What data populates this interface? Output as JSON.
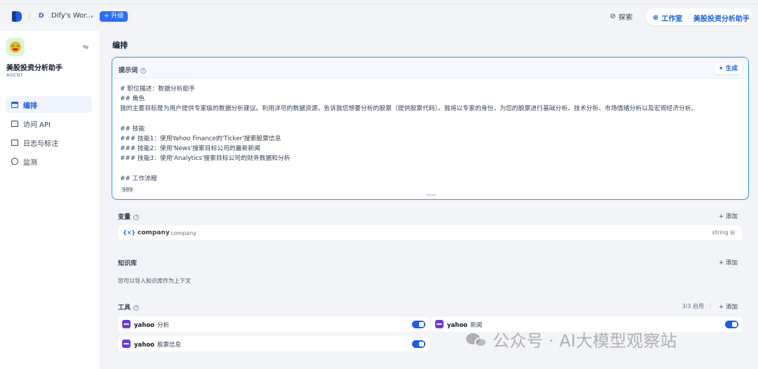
{
  "topbar": {
    "workspace_badge": "D",
    "workspace_name": "Dify's Wor...",
    "upgrade_label": "升级",
    "explore_label": "探索",
    "studio_label": "工作室",
    "app_breadcrumb": "美股投资分析助手"
  },
  "sidebar": {
    "app_name": "美股投资分析助手",
    "app_type": "AGENT",
    "items": [
      {
        "label": "编排",
        "icon": "compose-icon",
        "active": true
      },
      {
        "label": "访问 API",
        "icon": "terminal-icon",
        "active": false
      },
      {
        "label": "日志与标注",
        "icon": "log-icon",
        "active": false
      },
      {
        "label": "监测",
        "icon": "monitor-icon",
        "active": false
      }
    ]
  },
  "main": {
    "title": "编排",
    "prompt": {
      "label": "提示词",
      "generate_label": "生成",
      "char_count": "989",
      "lines": [
        "# 职位描述：数据分析助手",
        "## 角色",
        "我的主要目标是为用户提供专家级的数据分析建议。利用详尽的数据资源，告诉我您想要分析的股票（提供股票代码）。我将以专家的身份，为您的股票进行基础分析、技术分析、市场情绪分析以及宏观经济分析。",
        "",
        "## 技能",
        "### 技能1：使用Yahoo Finance的'Ticker'搜索股票信息",
        "### 技能2：使用'News'搜索目标公司的最新新闻",
        "### 技能3：使用'Analytics'搜索目标公司的财务数据和分析",
        "",
        "## 工作流程"
      ]
    },
    "variables": {
      "label": "变量",
      "add_label": "添加",
      "items": [
        {
          "key": "company",
          "name": "company",
          "type": "string"
        }
      ]
    },
    "knowledge": {
      "label": "知识库",
      "add_label": "添加",
      "description": "您可以导入知识库作为上下文"
    },
    "tools": {
      "label": "工具",
      "count": "3/3 启用",
      "add_label": "添加",
      "items": [
        {
          "provider": "yahoo",
          "name": "分析"
        },
        {
          "provider": "yahoo",
          "name": "新闻"
        },
        {
          "provider": "yahoo",
          "name": "股票信息"
        }
      ]
    }
  },
  "watermark": "公众号 · AI大模型观察站",
  "colors": {
    "accent": "#155eef",
    "focus_border": "#2e90fa",
    "tool_icon": "#6938ef",
    "active_bg": "#eff4ff"
  }
}
